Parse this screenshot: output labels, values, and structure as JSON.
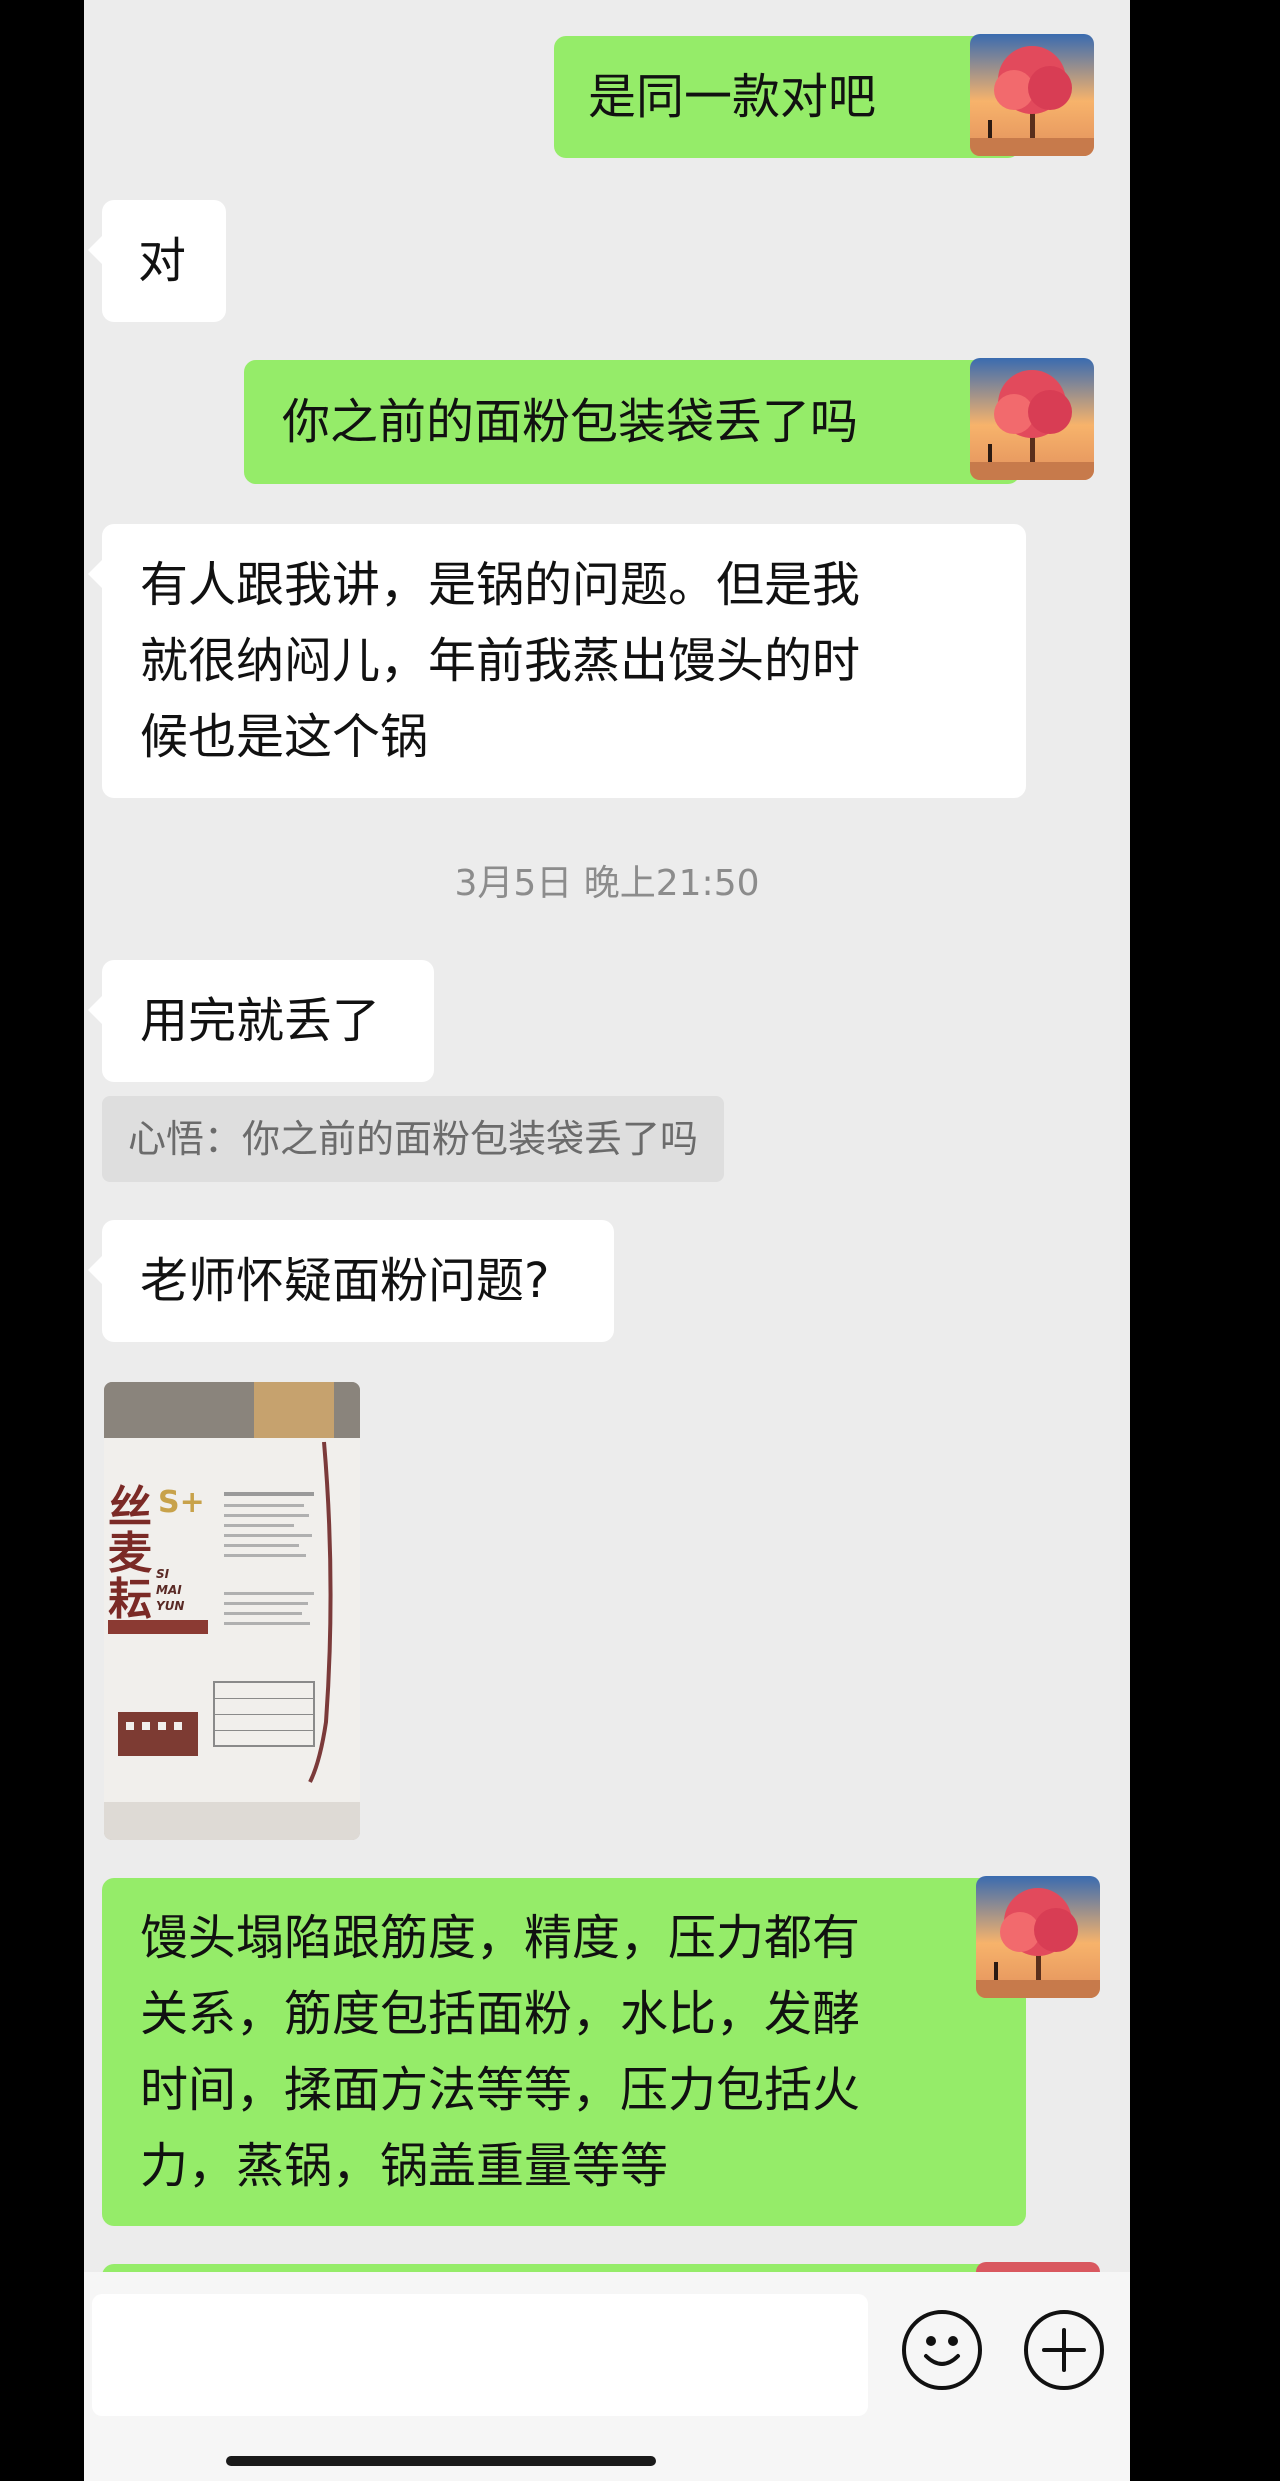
{
  "messages": {
    "m1": "是同一款对吧",
    "m2": "对",
    "m3": "你之前的面粉包装袋丢了吗",
    "m4_lines": [
      "有人跟我讲，是锅的问题。但是我",
      "就很纳闷儿，年前我蒸出馒头的时",
      "候也是这个锅"
    ],
    "m5": "用完就丢了",
    "m6": "老师怀疑面粉问题?",
    "m7_lines": [
      "馒头塌陷跟筋度，精度，压力都有",
      "关系，筋度包括面粉，水比，发酵",
      "时间，揉面方法等等，压力包括火",
      "力，蒸锅，锅盖重量等等"
    ]
  },
  "timestamp": "3月5日 晚上21:50",
  "quote": "心悟：你之前的面粉包装袋丢了吗",
  "photo": {
    "brand_cn": "丝麦耘",
    "brand_en": [
      "SI",
      "MAI",
      "YUN"
    ],
    "badge": "S+"
  },
  "colors": {
    "outgoing_bubble": "#95ec69",
    "incoming_bubble": "#ffffff",
    "chat_background": "#ececec"
  },
  "icons": [
    "smiley-icon",
    "plus-icon"
  ]
}
